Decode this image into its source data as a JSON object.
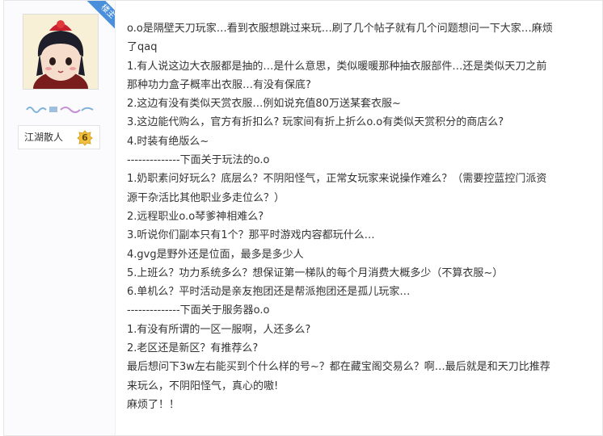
{
  "author": {
    "badge": "楼主",
    "rank_title": "江湖散人",
    "rank_level": "6",
    "colors": {
      "badge": "#4a8fdc",
      "level": "#f0c040"
    }
  },
  "post": {
    "lines": [
      "o.o是隔壁天刀玩家…看到衣服想跳过来玩…刷了几个帖子就有几个问题想问一下大家…麻烦",
      "了qaq",
      "1.有人说这边大衣服都是抽的…是什么意思，类似暖暖那种抽衣服部件…还是类似天刀之前",
      "那种功力盒子概率出衣服…有没有保底?",
      "2.这边有没有类似天赏衣服…例如说充值80万送某套衣服~",
      "3.这边能代购么，官方有折扣么? 玩家间有折上折么o.o有类似天赏积分的商店么?",
      "4.时装有绝版么~",
      "--------------下面关于玩法的o.o",
      "1.奶职素问好玩么？底层么？不阴阳怪气，正常女玩家来说操作难么？（需要控蓝控门派资",
      "源干杂活比其他职业多走位么？）",
      "2.远程职业o.o琴爹神相难么?",
      "3.听说你们副本只有1个？那平时游戏内容都玩什么…",
      "4.gvg是野外还是位面，最多是多少人",
      "5.上班么？功力系统多么？想保证第一梯队的每个月消费大概多少（不算衣服~）",
      "6.单机么？平时活动是亲友抱团还是帮派抱团还是孤儿玩家…",
      "--------------下面关于服务器o.o",
      "1.有没有所谓的一区一服啊，人还多么?",
      "2.老区还是新区？有推荐么?",
      "最后想问下3w左右能买到个什么样的号~？都在藏宝阁交易么？啊…最后就是和天刀比推荐",
      "来玩么，不阴阳怪气，真心的嗷!",
      "麻烦了！！"
    ]
  }
}
